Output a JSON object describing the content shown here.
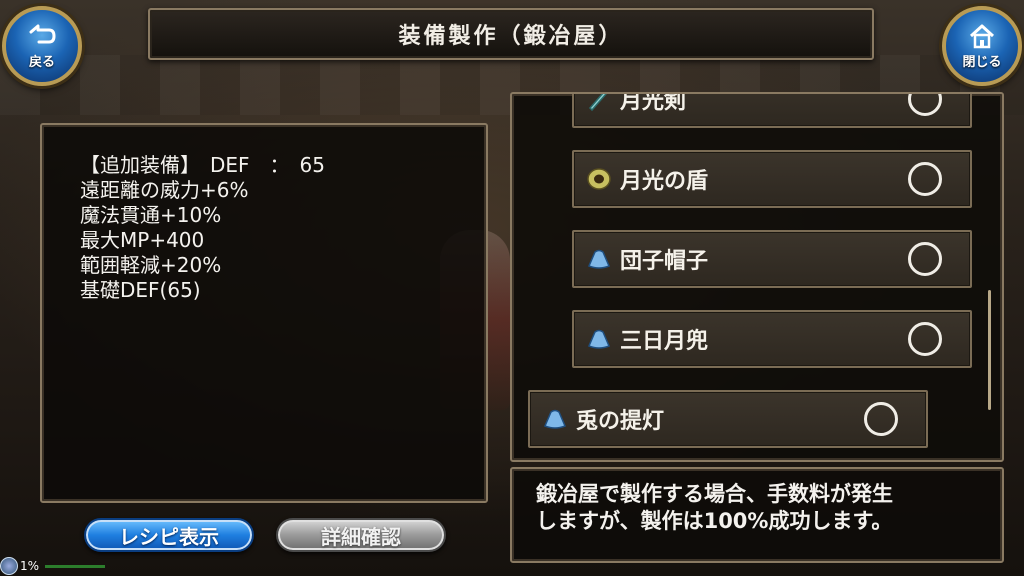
{
  "header": {
    "title": "装備製作（鍛冶屋）",
    "back_label": "戻る",
    "close_label": "閉じる"
  },
  "stats": {
    "lines": [
      "【追加装備】　DEF　：　65",
      "遠距離の威力+6%",
      "魔法貫通+10%",
      "最大MP+400",
      "範囲軽減+20%",
      "基礎DEF(65)"
    ]
  },
  "buttons": {
    "recipe_label": "レシピ表示",
    "detail_label": "詳細確認"
  },
  "item_list": {
    "items": [
      {
        "name": "月光剣",
        "icon": "sword-icon"
      },
      {
        "name": "月光の盾",
        "icon": "shield-icon"
      },
      {
        "name": "団子帽子",
        "icon": "hat-icon"
      },
      {
        "name": "三日月兜",
        "icon": "helmet-icon"
      },
      {
        "name": "兎の提灯",
        "icon": "lantern-icon"
      }
    ]
  },
  "message": {
    "line1": "鍛冶屋で製作する場合、手数料が発生",
    "line2": "しますが、製作は100%成功します。"
  },
  "status": {
    "text": "1%",
    "progress": 0.01
  },
  "colors": {
    "accent_blue": "#1f7fe0",
    "frame_gold": "#8a7a62",
    "disabled_gray": "#9a9a9a"
  }
}
